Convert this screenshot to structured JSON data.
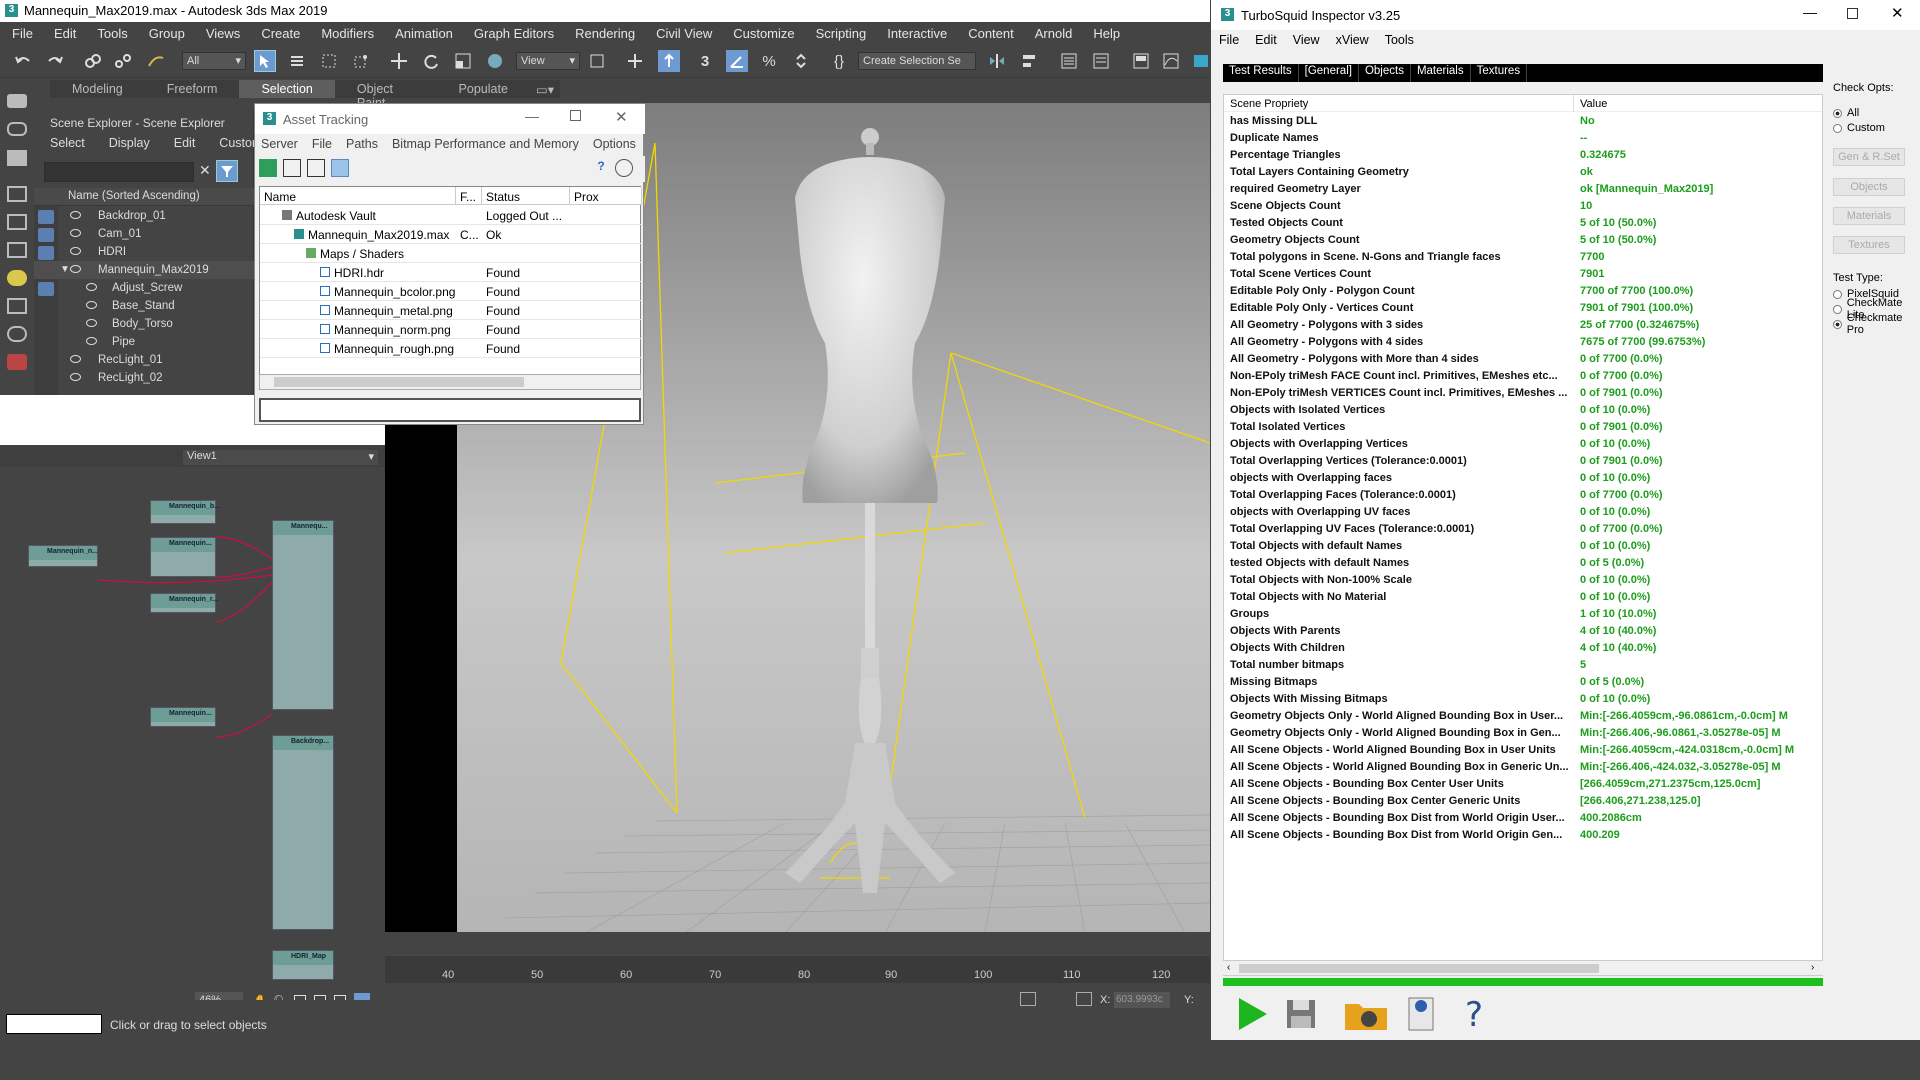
{
  "max": {
    "title": "Mannequin_Max2019.max - Autodesk 3ds Max 2019",
    "menu": [
      "File",
      "Edit",
      "Tools",
      "Group",
      "Views",
      "Create",
      "Modifiers",
      "Animation",
      "Graph Editors",
      "Rendering",
      "Civil View",
      "Customize",
      "Scripting",
      "Interactive",
      "Content",
      "Arnold",
      "Help"
    ],
    "toolbar": {
      "filter_value": "All",
      "ref_coord": "View",
      "selection_set": "Create Selection Se"
    },
    "ribbon_tabs": [
      "Modeling",
      "Freeform",
      "Selection",
      "Object Paint",
      "Populate"
    ],
    "ribbon_selected": "Selection",
    "scene_explorer": {
      "title": "Scene Explorer - Scene Explorer",
      "menu": [
        "Select",
        "Display",
        "Edit",
        "Customiz"
      ],
      "column": "Name (Sorted Ascending)",
      "rows": [
        "Backdrop_01",
        "Cam_01",
        "HDRI",
        "Mannequin_Max2019",
        "Adjust_Screw",
        "Base_Stand",
        "Body_Torso",
        "Pipe",
        "RecLight_01",
        "RecLight_02"
      ]
    },
    "slate": {
      "view_name": "View1",
      "zoom": "46%"
    },
    "timeline": [
      "40",
      "50",
      "60",
      "70",
      "80",
      "90",
      "100",
      "110",
      "120"
    ],
    "status": {
      "prompt": "Click or drag to select objects",
      "x_label": "X:",
      "x_value": "603.9993c",
      "y_label": "Y:"
    }
  },
  "asset": {
    "title": "Asset Tracking",
    "menu": [
      "Server",
      "File",
      "Paths",
      "Bitmap Performance and Memory",
      "Options"
    ],
    "columns": [
      "Name",
      "F...",
      "Status",
      "Prox"
    ],
    "rows": [
      {
        "name": "Autodesk Vault",
        "f": "",
        "status": "Logged Out ..."
      },
      {
        "name": "Mannequin_Max2019.max",
        "f": "C...",
        "status": "Ok"
      },
      {
        "name": "Maps / Shaders",
        "f": "",
        "status": ""
      },
      {
        "name": "HDRI.hdr",
        "f": "",
        "status": "Found"
      },
      {
        "name": "Mannequin_bcolor.png",
        "f": "",
        "status": "Found"
      },
      {
        "name": "Mannequin_metal.png",
        "f": "",
        "status": "Found"
      },
      {
        "name": "Mannequin_norm.png",
        "f": "",
        "status": "Found"
      },
      {
        "name": "Mannequin_rough.png",
        "f": "",
        "status": "Found"
      }
    ]
  },
  "ts": {
    "title": "TurboSquid Inspector v3.25",
    "menu": [
      "File",
      "Edit",
      "View",
      "xView",
      "Tools"
    ],
    "tabs": [
      "Test Results",
      "[General]",
      "Objects",
      "Materials",
      "Textures"
    ],
    "col_prop": "Scene Propriety",
    "col_val": "Value",
    "rows": [
      [
        "has Missing DLL",
        "No"
      ],
      [
        "Duplicate Names",
        "--"
      ],
      [
        "Percentage Triangles",
        "0.324675"
      ],
      [
        "Total Layers Containing Geometry",
        "ok"
      ],
      [
        "required Geometry Layer",
        "ok [Mannequin_Max2019]"
      ],
      [
        "Scene Objects Count",
        "10"
      ],
      [
        "Tested Objects Count",
        "5 of 10 (50.0%)"
      ],
      [
        "Geometry Objects Count",
        "5 of 10 (50.0%)"
      ],
      [
        "Total polygons in Scene. N-Gons and Triangle faces",
        "7700"
      ],
      [
        "Total Scene Vertices Count",
        "7901"
      ],
      [
        "Editable Poly Only - Polygon Count",
        "7700 of 7700 (100.0%)"
      ],
      [
        "Editable Poly Only - Vertices Count",
        "7901 of 7901 (100.0%)"
      ],
      [
        "All Geometry - Polygons with 3 sides",
        "25 of 7700 (0.324675%)"
      ],
      [
        "All Geometry - Polygons with 4 sides",
        "7675 of 7700 (99.6753%)"
      ],
      [
        "All Geometry - Polygons with More than 4 sides",
        "0 of 7700 (0.0%)"
      ],
      [
        "Non-EPoly triMesh FACE Count incl. Primitives, EMeshes etc...",
        "0 of 7700 (0.0%)"
      ],
      [
        "Non-EPoly triMesh VERTICES Count incl. Primitives, EMeshes ...",
        "0 of 7901 (0.0%)"
      ],
      [
        "Objects with Isolated Vertices",
        "0 of 10 (0.0%)"
      ],
      [
        "Total Isolated Vertices",
        "0 of 7901 (0.0%)"
      ],
      [
        "Objects with Overlapping Vertices",
        "0 of 10 (0.0%)"
      ],
      [
        "Total Overlapping Vertices (Tolerance:0.0001)",
        "0 of 7901 (0.0%)"
      ],
      [
        "objects with Overlapping faces",
        "0 of 10 (0.0%)"
      ],
      [
        "Total Overlapping Faces (Tolerance:0.0001)",
        "0 of 7700 (0.0%)"
      ],
      [
        "objects with Overlapping UV faces",
        "0 of 10 (0.0%)"
      ],
      [
        "Total Overlapping UV Faces (Tolerance:0.0001)",
        "0 of 7700 (0.0%)"
      ],
      [
        "Total Objects with default Names",
        "0 of 10 (0.0%)"
      ],
      [
        "tested Objects with default Names",
        "0 of 5 (0.0%)"
      ],
      [
        "Total Objects with Non-100% Scale",
        "0 of 10 (0.0%)"
      ],
      [
        "Total Objects with No Material",
        "0 of 10 (0.0%)"
      ],
      [
        "Groups",
        "1 of 10 (10.0%)"
      ],
      [
        "Objects With Parents",
        "4 of 10 (40.0%)"
      ],
      [
        "Objects With Children",
        "4 of 10 (40.0%)"
      ],
      [
        "Total number bitmaps",
        "5"
      ],
      [
        "Missing Bitmaps",
        "0 of 5 (0.0%)"
      ],
      [
        "Objects With Missing Bitmaps",
        "0 of 10 (0.0%)"
      ],
      [
        "Geometry Objects Only - World Aligned Bounding Box in User...",
        "Min:[-266.4059cm,-96.0861cm,-0.0cm]  M"
      ],
      [
        "Geometry Objects Only - World Aligned Bounding Box in Gen...",
        "Min:[-266.406,-96.0861,-3.05278e-05]  M"
      ],
      [
        "All Scene Objects - World Aligned Bounding Box in User Units",
        "Min:[-266.4059cm,-424.0318cm,-0.0cm]  M"
      ],
      [
        "All Scene Objects - World Aligned Bounding Box in Generic Un...",
        "Min:[-266.406,-424.032,-3.05278e-05]  M"
      ],
      [
        "All Scene Objects - Bounding Box Center User Units",
        "[266.4059cm,271.2375cm,125.0cm]"
      ],
      [
        "All Scene Objects - Bounding Box Center Generic Units",
        "[266.406,271.238,125.0]"
      ],
      [
        "All Scene Objects - Bounding Box Dist from World Origin User...",
        "400.2086cm"
      ],
      [
        "All Scene Objects - Bounding Box Dist from World Origin Gen...",
        "400.209"
      ]
    ],
    "check_opts": {
      "title": "Check Opts:",
      "options": [
        "All",
        "Custom"
      ],
      "selected": "All"
    },
    "buttons": [
      "Gen & R.Set",
      "Objects",
      "Materials",
      "Textures"
    ],
    "test_type": {
      "title": "Test Type:",
      "options": [
        "PixelSquid",
        "CheckMate Lite",
        "Checkmate Pro"
      ],
      "selected": "Checkmate Pro"
    },
    "colors": {
      "value": "#1b9e1b",
      "progress": "#1dbf1d"
    }
  }
}
